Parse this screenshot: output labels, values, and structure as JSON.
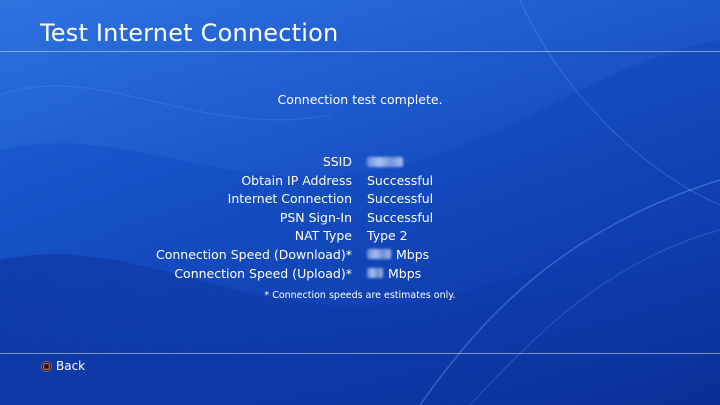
{
  "header": {
    "title": "Test Internet Connection"
  },
  "status": {
    "message": "Connection test complete."
  },
  "results": [
    {
      "label": "SSID",
      "value": ""
    },
    {
      "label": "Obtain IP Address",
      "value": "Successful"
    },
    {
      "label": "Internet Connection",
      "value": "Successful"
    },
    {
      "label": "PSN Sign-In",
      "value": "Successful"
    },
    {
      "label": "NAT Type",
      "value": "Type 2"
    },
    {
      "label": "Connection Speed (Download)*",
      "value": "Mbps"
    },
    {
      "label": "Connection Speed (Upload)*",
      "value": "Mbps"
    }
  ],
  "footnote": "* Connection speeds are estimates only.",
  "footer": {
    "back_label": "Back",
    "back_icon": "circle-button-icon"
  },
  "colors": {
    "background": "#1652c7",
    "circle_button_accent": "#ff5a6e"
  }
}
